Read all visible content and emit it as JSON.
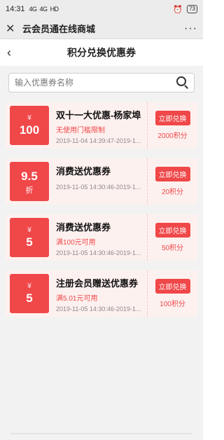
{
  "status_bar": {
    "time": "14:31",
    "signal_1": "4G",
    "signal_2": "4G",
    "network": "HD",
    "battery": "73"
  },
  "title_bar": {
    "title": "云会员通在线商城",
    "more": "···"
  },
  "nav": {
    "title": "积分兑换优惠券"
  },
  "search": {
    "placeholder": "输入优惠券名称",
    "value": ""
  },
  "coupons": [
    {
      "symbol": "¥",
      "value": "100",
      "unit": "",
      "name": "双十一大优惠-杨家埠",
      "condition": "无使用门槛限制",
      "date": "2019-11-04 14:39:47-2019-11-0...",
      "button": "立即兑换",
      "points": "2000积分"
    },
    {
      "symbol": "",
      "value": "9.5",
      "unit": "折",
      "name": "消费送优惠券",
      "condition": "",
      "date": "2019-11-05 14:30:46-2019-11-0...",
      "button": "立即兑换",
      "points": "20积分"
    },
    {
      "symbol": "¥",
      "value": "5",
      "unit": "",
      "name": "消费送优惠券",
      "condition": "满100元可用",
      "date": "2019-11-05 14:30:46-2019-11-0...",
      "button": "立即兑换",
      "points": "50积分"
    },
    {
      "symbol": "¥",
      "value": "5",
      "unit": "",
      "name": "注册会员赠送优惠券",
      "condition": "满5.01元可用",
      "date": "2019-11-05 14:30:46-2019-11-1...",
      "button": "立即兑换",
      "points": "100积分"
    }
  ],
  "colors": {
    "accent": "#f04749",
    "card_bg": "#fdf1ef",
    "page_bg": "#f2f2f2"
  }
}
